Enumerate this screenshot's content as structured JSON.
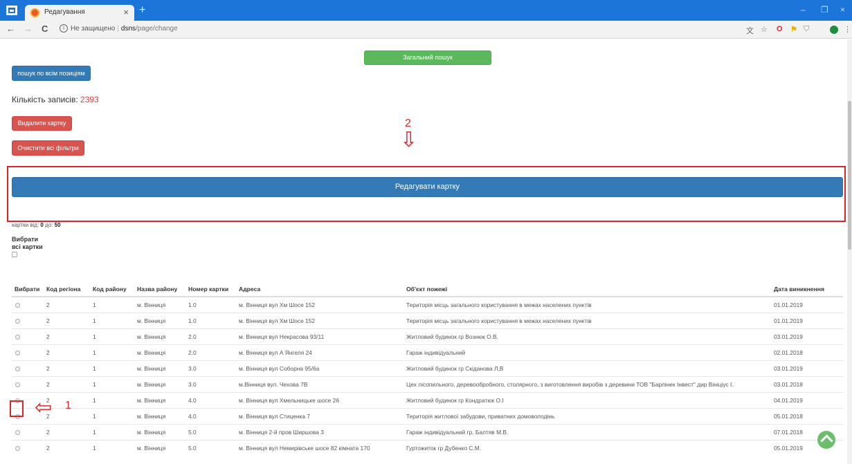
{
  "browser": {
    "tab_title": "Редагування",
    "tab_close": "×",
    "new_tab": "+",
    "nav_back": "←",
    "nav_forward": "→",
    "nav_reload": "C",
    "security": "Не защищено",
    "url_host": "dsns",
    "url_path": "/page/change",
    "win_minimize": "–",
    "win_restore": "❐",
    "win_close": "×"
  },
  "toolbar": {
    "general_search": "Загальний пошук",
    "search_all_positions": "пошук по всім позиціям",
    "records_label": "Кількість записів:",
    "records_count": "2393",
    "delete_card": "Видалити картку",
    "clear_filters": "Очистити всі фільтри",
    "edit_card": "Редагувати картку"
  },
  "annotations": {
    "marker_1": "1",
    "marker_2": "2",
    "arrow_2": "⇩",
    "arrow_1": "⇦",
    "color": "#d9252a"
  },
  "range": {
    "prefix": "картки від:",
    "from": "0",
    "middle": "до:",
    "to": "50"
  },
  "select_all": {
    "line1": "Вибрати",
    "line2": "всі картки"
  },
  "table": {
    "headers": [
      "Вибрати",
      "Код регіона",
      "Код району",
      "Назва району",
      "Номер картки",
      "Адреса",
      "Об'єкт пожежі",
      "Дата виникнення"
    ],
    "rows": [
      [
        "2",
        "1",
        "м. Вінниця",
        "1.0",
        "м. Вінниця вул Хм Шосе 152",
        "Територія місць загального користування в межах населених пунктів",
        "01.01.2019"
      ],
      [
        "2",
        "1",
        "м. Вінниця",
        "1.0",
        "м. Вінниця вул Хм Шосе 152",
        "Територія місць загального користування в межах населених пунктів",
        "01.01.2019"
      ],
      [
        "2",
        "1",
        "м. Вінниця",
        "2.0",
        "м. Вінниця вул Некрасова 93/11",
        "Житловий будинок гр Вознюк О.В.",
        "03.01.2019"
      ],
      [
        "2",
        "1",
        "м. Вінниця",
        "2.0",
        "м. Вінниця вул А Янгеля 24",
        "Гараж індивідуальний",
        "02.01.2018"
      ],
      [
        "2",
        "1",
        "м. Вінниця",
        "3.0",
        "м. Вінниця вул Соборна 95/6а",
        "Житловий будинок гр Скіданова Л,В",
        "03.01.2019"
      ],
      [
        "2",
        "1",
        "м. Вінниця",
        "3.0",
        "м.Вінниця вул. Чехова 7В",
        "Цех лісопильного, деревообробного, столярного, з виготовлення виробів з деревини ТОВ \"Барлінек Інвест\" дир Вініціус І.",
        "03.01.2018"
      ],
      [
        "2",
        "1",
        "м. Вінниця",
        "4.0",
        "м. Вінниця вул Хмельницьке шосе 26",
        "Житловий будинок гр Кондратюк О.І",
        "04.01.2019"
      ],
      [
        "2",
        "1",
        "м. Вінниця",
        "4.0",
        "м. Вінниця вул Стиценка 7",
        "Територія житлової забудови, приватних домоволодінь",
        "05.01.2018"
      ],
      [
        "2",
        "1",
        "м. Вінниця",
        "5.0",
        "м. Вінниця 2-й пров Ширшова 3",
        "Гараж індивідуальний гр. Балтяв М.В.",
        "07.01.2018"
      ],
      [
        "2",
        "1",
        "м. Вінниця",
        "5.0",
        "м. Вінниця вул Немирівське шосе 82 кімната 170",
        "Гуртожиток гр Дубенко С.М.",
        "05.01.2019"
      ]
    ]
  }
}
